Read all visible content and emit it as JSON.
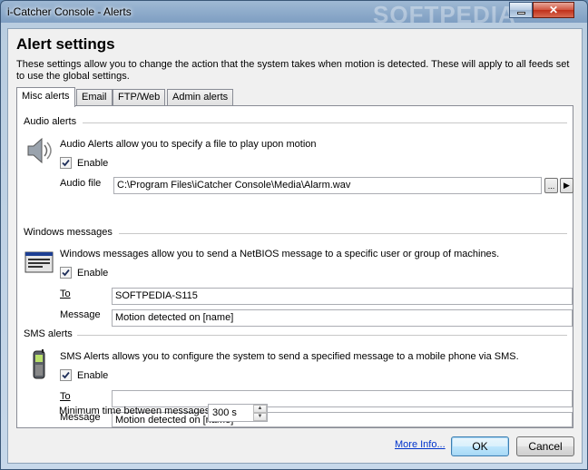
{
  "window": {
    "title": "i-Catcher Console - Alerts",
    "watermark": "SOFTPEDIA",
    "close_glyph": "✕"
  },
  "header": {
    "title": "Alert settings",
    "description": "These settings allow you to change the action that the system takes when motion is detected. These will apply to all feeds set to use the global settings."
  },
  "tabs": [
    {
      "label": "Misc alerts",
      "active": true
    },
    {
      "label": "Email",
      "active": false
    },
    {
      "label": "FTP/Web",
      "active": false
    },
    {
      "label": "Admin alerts",
      "active": false
    }
  ],
  "audio": {
    "section_label": "Audio alerts",
    "icon": "speaker-icon",
    "description": "Audio Alerts allow you to specify a file to play upon motion",
    "enable_label": "Enable",
    "enabled": true,
    "file_label": "Audio file",
    "file_value": "C:\\Program Files\\iCatcher Console\\Media\\Alarm.wav",
    "browse_label": "...",
    "play_glyph": "▶"
  },
  "windows_messages": {
    "section_label": "Windows messages",
    "icon": "network-message-icon",
    "description": "Windows messages allow you to send a NetBIOS message to a specific user or group of machines.",
    "enable_label": "Enable",
    "enabled": true,
    "to_label": "To",
    "to_value": "SOFTPEDIA-S115",
    "message_label": "Message",
    "message_value": "Motion detected on [name]"
  },
  "sms": {
    "section_label": "SMS alerts",
    "icon": "mobile-phone-icon",
    "description": "SMS Alerts allows you to configure the system to send a specified message to a mobile phone via SMS.",
    "enable_label": "Enable",
    "enabled": true,
    "to_label": "To",
    "to_value": "",
    "message_label": "Message",
    "message_value": "Motion detected on [name]",
    "min_time_label": "Minimum time between messages",
    "min_time_value": "300 s"
  },
  "footer": {
    "more_info": "More Info...",
    "ok": "OK",
    "cancel": "Cancel"
  },
  "colors": {
    "accent": "#3c7fb1",
    "link": "#0033cc"
  }
}
